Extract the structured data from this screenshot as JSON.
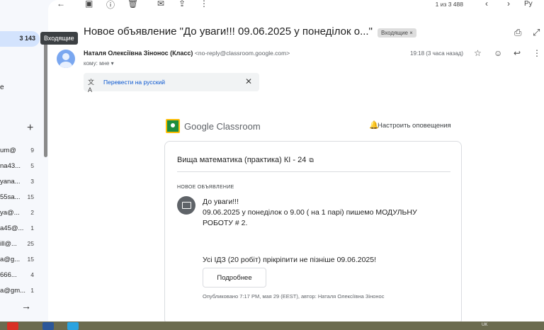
{
  "sidebar": {
    "inbox_count": "3 143",
    "tooltip": "Входящие",
    "partial_letter": "e",
    "plus_label": "+",
    "labels": [
      {
        "name": "um@",
        "count": "9"
      },
      {
        "name": "na43...",
        "count": "5"
      },
      {
        "name": "yana...",
        "count": "3"
      },
      {
        "name": "55sa...",
        "count": "15"
      },
      {
        "name": "ya@...",
        "count": "2"
      },
      {
        "name": "a45@...",
        "count": "1"
      },
      {
        "name": "ill@...",
        "count": "25"
      },
      {
        "name": "a@g...",
        "count": "15"
      },
      {
        "name": "666...",
        "count": "4"
      },
      {
        "name": "a@gm...",
        "count": "1"
      }
    ]
  },
  "toolbar": {
    "pager": "1 из 3 488",
    "input_tool": "Py"
  },
  "email": {
    "subject": "Новое объявление \"До уваги!!! 09.06.2025 у понеділок о...\"",
    "label_chip": "Входящие ×",
    "sender_name": "Наталя Олексіївна Зінонос (Класс)",
    "sender_address": "<no-reply@classroom.google.com>",
    "to": "кому: мне ▾",
    "time": "19:18 (3 часа назад)",
    "translate": "Перевести на русский"
  },
  "classroom": {
    "brand": "Google Classroom",
    "notify": "Настроить оповещения",
    "course": "Вища математика (практика) КІ - 24",
    "section": "НОВОЕ ОБЪЯВЛЕНИЕ",
    "lines": [
      "До уваги!!!",
      "09.06.2025 у понеділок о 9.00 ( на 1 парі) пишемо МОДУЛЬНУ",
      "РОБОТУ # 2.",
      "Усі ІДЗ (20 робіт) прікріпити не пізніше 09.06.2025!"
    ],
    "more_button": "Подробнее",
    "published": "Опубликовано 7:17 PM, мая 29 (EEST), автор: Наталя Олексіївна Зінонос"
  },
  "taskbar": {
    "tray_lang": "UK"
  }
}
